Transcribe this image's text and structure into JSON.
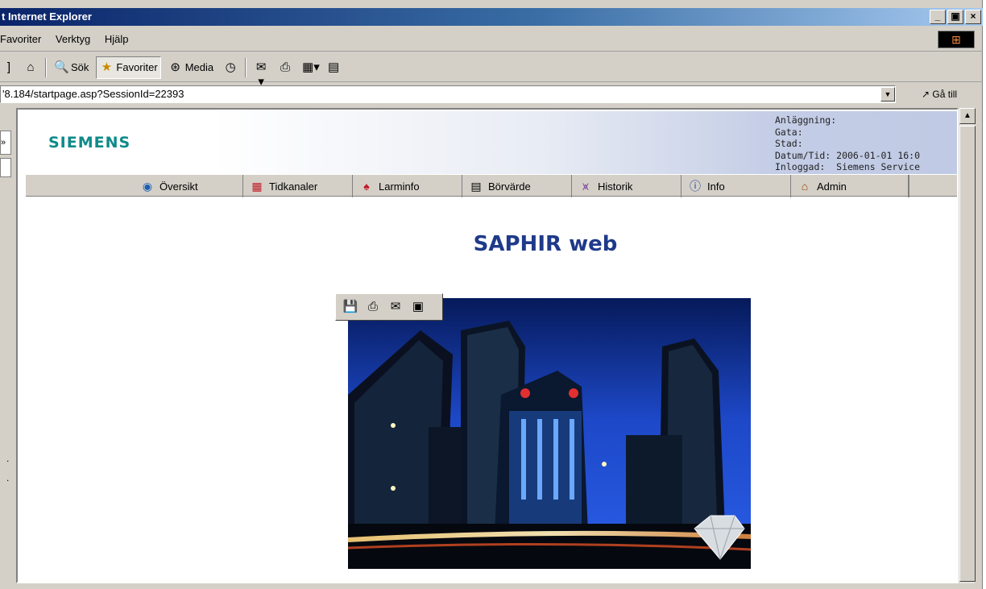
{
  "window": {
    "title": "t Internet Explorer",
    "min": "_",
    "max": "▣",
    "close": "×"
  },
  "menu": {
    "items": [
      "Favoriter",
      "Verktyg",
      "Hjälp"
    ]
  },
  "toolbar": {
    "search": "Sök",
    "favorites": "Favoriter",
    "media": "Media"
  },
  "address": {
    "url": "'8.184/startpage.asp?SessionId=22393",
    "go": "Gå till"
  },
  "banner": {
    "logo": "SIEMENS",
    "info_lines": "Anläggning:\nGata:\nStad:\nDatum/Tid: 2006-01-01 16:0\nInloggad:  Siemens Service"
  },
  "nav": {
    "items": [
      {
        "label": "Översikt",
        "icon": "overview-icon"
      },
      {
        "label": "Tidkanaler",
        "icon": "timechannel-icon"
      },
      {
        "label": "Larminfo",
        "icon": "alarm-icon"
      },
      {
        "label": "Börvärde",
        "icon": "setpoint-icon"
      },
      {
        "label": "Historik",
        "icon": "history-icon"
      },
      {
        "label": "Info",
        "icon": "info-icon"
      },
      {
        "label": "Admin",
        "icon": "admin-icon"
      }
    ]
  },
  "main": {
    "title": "SAPHIR web"
  },
  "colors": {
    "logo": "#0f8a8a",
    "title": "#1f3a8a",
    "titlebar": "#0a246a"
  }
}
